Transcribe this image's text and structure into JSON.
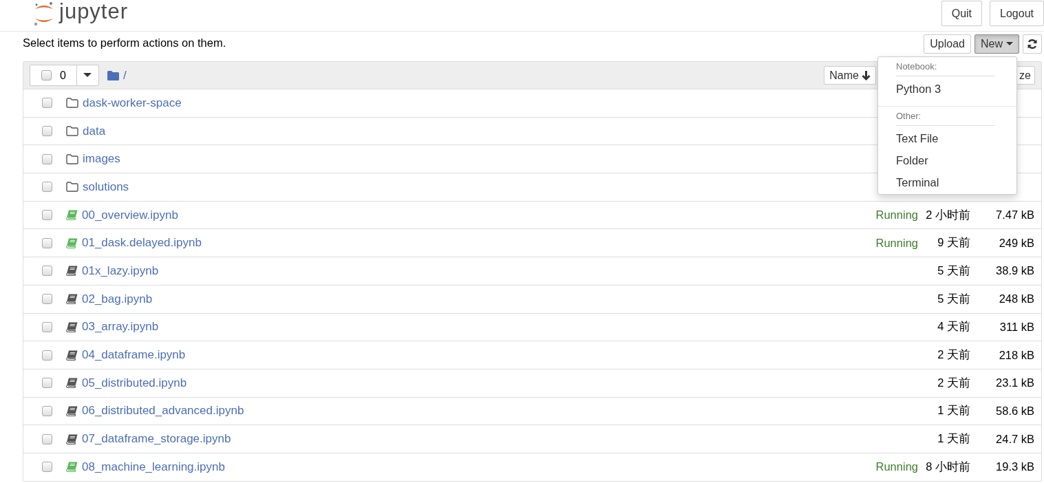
{
  "header": {
    "logo_text": "jupyter",
    "buttons": [
      "Quit",
      "Logout"
    ]
  },
  "toolbar": {
    "hint": "Select items to perform actions on them.",
    "buttons": [
      "Upload",
      "New"
    ],
    "new_open": true
  },
  "list_header": {
    "selected_count": "0",
    "checked": false,
    "path": "/",
    "sort_buttons": [
      "Name",
      "ze"
    ]
  },
  "new_menu": {
    "sections": [
      {
        "heading": "Notebook:",
        "items": [
          "Python 3"
        ]
      },
      {
        "heading": "Other:",
        "items": [
          "Text File",
          "Folder",
          "Terminal"
        ]
      }
    ]
  },
  "rows": [
    {
      "kind": "folder",
      "name": "dask-worker-space",
      "checked": false
    },
    {
      "kind": "folder",
      "name": "data",
      "checked": false
    },
    {
      "kind": "folder",
      "name": "images",
      "checked": false
    },
    {
      "kind": "folder",
      "name": "solutions",
      "checked": false
    },
    {
      "kind": "notebook",
      "name": "00_overview.ipynb",
      "checked": false,
      "running": true,
      "status": "Running",
      "modified": "2 小时前",
      "size": "7.47 kB"
    },
    {
      "kind": "notebook",
      "name": "01_dask.delayed.ipynb",
      "checked": false,
      "running": true,
      "status": "Running",
      "modified": "9 天前",
      "size": "249 kB"
    },
    {
      "kind": "notebook",
      "name": "01x_lazy.ipynb",
      "checked": false,
      "running": false,
      "modified": "5 天前",
      "size": "38.9 kB"
    },
    {
      "kind": "notebook",
      "name": "02_bag.ipynb",
      "checked": false,
      "running": false,
      "modified": "5 天前",
      "size": "248 kB"
    },
    {
      "kind": "notebook",
      "name": "03_array.ipynb",
      "checked": false,
      "running": false,
      "modified": "4 天前",
      "size": "311 kB"
    },
    {
      "kind": "notebook",
      "name": "04_dataframe.ipynb",
      "checked": false,
      "running": false,
      "modified": "2 天前",
      "size": "218 kB"
    },
    {
      "kind": "notebook",
      "name": "05_distributed.ipynb",
      "checked": false,
      "running": false,
      "modified": "2 天前",
      "size": "23.1 kB"
    },
    {
      "kind": "notebook",
      "name": "06_distributed_advanced.ipynb",
      "checked": false,
      "running": false,
      "modified": "1 天前",
      "size": "58.6 kB"
    },
    {
      "kind": "notebook",
      "name": "07_dataframe_storage.ipynb",
      "checked": false,
      "running": false,
      "modified": "1 天前",
      "size": "24.7 kB"
    },
    {
      "kind": "notebook",
      "name": "08_machine_learning.ipynb",
      "checked": false,
      "running": true,
      "status": "Running",
      "modified": "8 小时前",
      "size": "19.3 kB"
    }
  ]
}
